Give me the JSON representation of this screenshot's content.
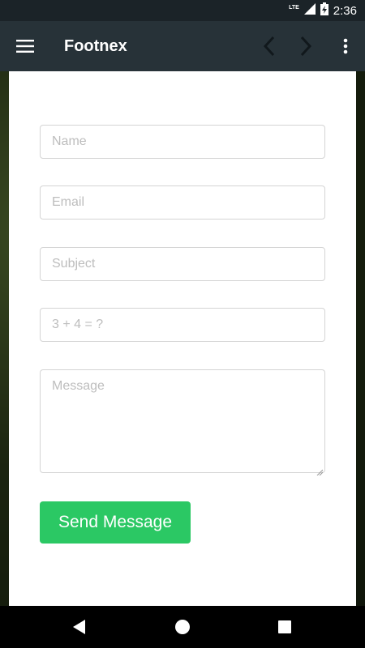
{
  "status_bar": {
    "network": "LTE",
    "time": "2:36"
  },
  "app_bar": {
    "title": "Footnex"
  },
  "form": {
    "name_placeholder": "Name",
    "email_placeholder": "Email",
    "subject_placeholder": "Subject",
    "captcha_placeholder": "3 + 4 = ?",
    "message_placeholder": "Message",
    "send_label": "Send Message"
  },
  "colors": {
    "app_bar": "#273238",
    "status_bar": "#1b2328",
    "send_button": "#2bc864"
  },
  "icons": [
    "menu-icon",
    "back-arrow-icon",
    "forward-arrow-icon",
    "more-options-icon",
    "signal-icon",
    "battery-icon",
    "nav-back-icon",
    "nav-home-icon",
    "nav-recent-icon"
  ]
}
